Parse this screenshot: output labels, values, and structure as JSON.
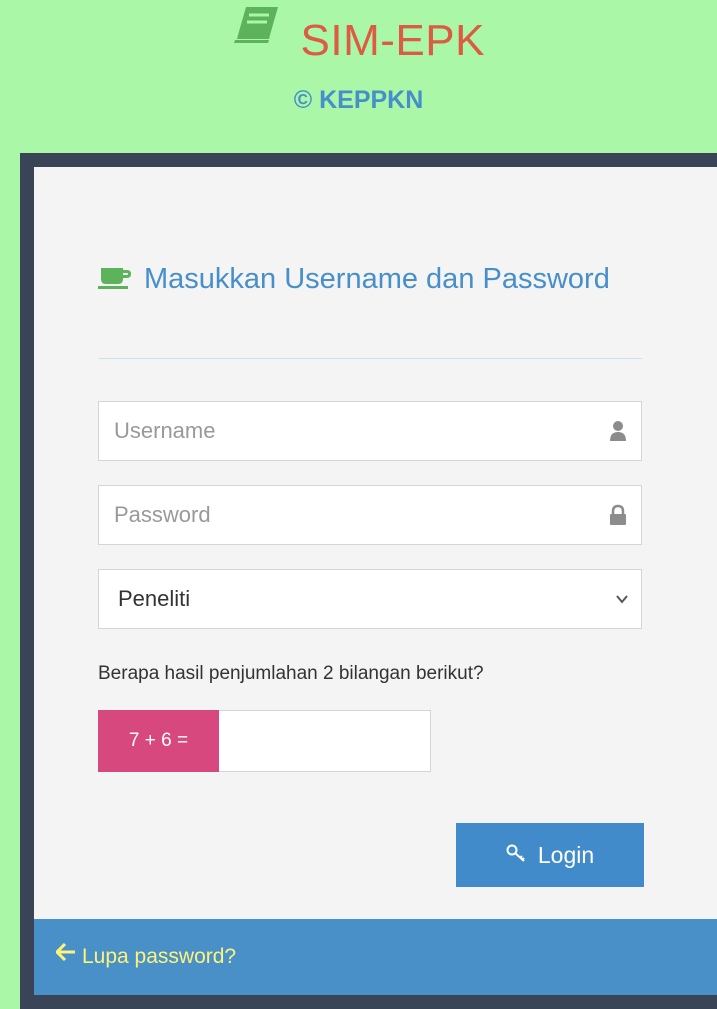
{
  "header": {
    "title": "SIM-EPK",
    "copyright": "© KEPPKN",
    "brand_icon": "book-icon",
    "title_color": "#dd5a43",
    "copyright_color": "#478fca"
  },
  "login_form": {
    "heading": "Masukkan Username dan Password",
    "heading_icon": "coffee-icon",
    "username": {
      "placeholder": "Username",
      "value": "",
      "icon": "user-icon"
    },
    "password": {
      "placeholder": "Password",
      "value": "",
      "icon": "lock-icon"
    },
    "role_select": {
      "selected": "Peneliti",
      "icon": "chevron-down-icon"
    },
    "captcha": {
      "question": "Berapa hasil penjumlahan 2 bilangan berikut?",
      "expression": "7 + 6 =",
      "value": "",
      "color": "#d6487e"
    },
    "login_button": {
      "label": "Login",
      "icon": "key-icon",
      "color": "#428bca"
    }
  },
  "toolbar": {
    "forgot_password_label": "Lupa password?",
    "forgot_icon": "arrow-left-icon",
    "link_color": "#fef37a"
  }
}
